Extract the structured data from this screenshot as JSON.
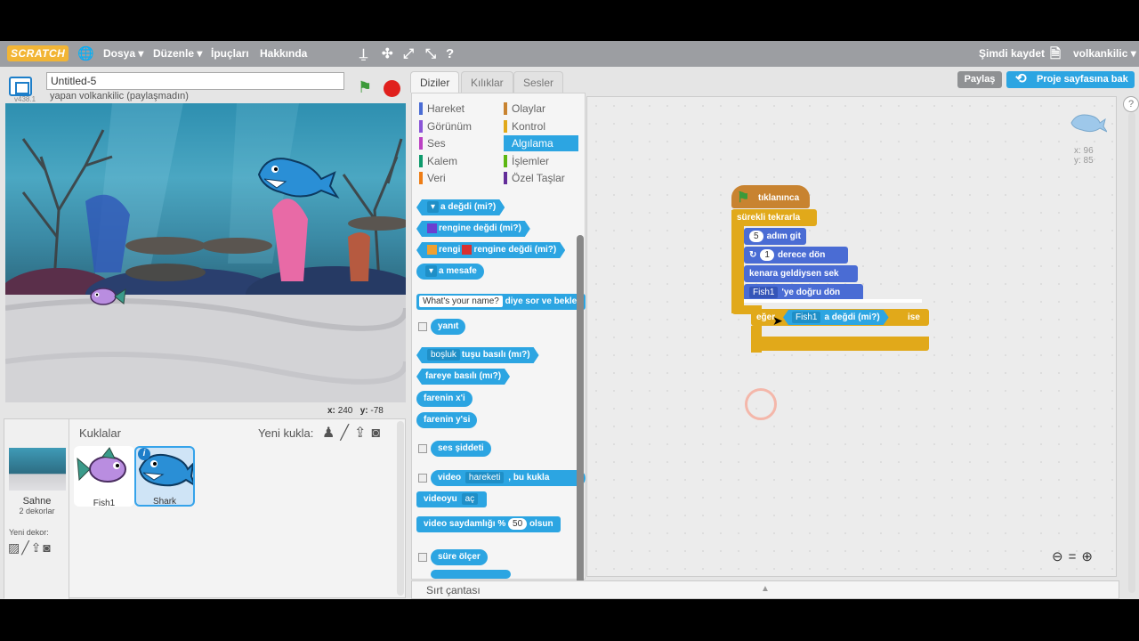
{
  "topbar": {
    "logo": "SCRATCH",
    "menus": [
      "Dosya ▾",
      "Düzenle ▾",
      "İpuçları",
      "Hakkında"
    ],
    "save_now": "Şimdi kaydet",
    "username": "volkankilic ▾"
  },
  "stage": {
    "project_title": "Untitled-5",
    "owner_text": "yapan volkankilic (paylaşmadın)",
    "version": "v438.1",
    "coords_x_label": "x:",
    "coords_x": "240",
    "coords_y_label": "y:",
    "coords_y": "-78"
  },
  "sprites_panel": {
    "stage_label": "Sahne",
    "backdrops_count": "2 dekorlar",
    "new_backdrop": "Yeni dekor:",
    "sprites_title": "Kuklalar",
    "new_sprite": "Yeni kukla:",
    "sprites": [
      {
        "name": "Fish1"
      },
      {
        "name": "Shark"
      }
    ],
    "info_glyph": "i"
  },
  "tabs": [
    "Diziler",
    "Kılıklar",
    "Sesler"
  ],
  "categories": [
    {
      "label": "Hareket",
      "color": "#4a6cd4"
    },
    {
      "label": "Olaylar",
      "color": "#c88330"
    },
    {
      "label": "Görünüm",
      "color": "#8a55d7"
    },
    {
      "label": "Kontrol",
      "color": "#e1a91a"
    },
    {
      "label": "Ses",
      "color": "#bb42c3"
    },
    {
      "label": "Algılama",
      "color": "#2ca5e2"
    },
    {
      "label": "Kalem",
      "color": "#0e9a6c"
    },
    {
      "label": "İşlemler",
      "color": "#5cb712"
    },
    {
      "label": "Veri",
      "color": "#ee7d16"
    },
    {
      "label": "Özel Taşlar",
      "color": "#632d99"
    }
  ],
  "palette": {
    "touching": "a değdi (mi?)",
    "touching_color": "rengine değdi (mi?)",
    "color_word": "rengi",
    "color_touching_color": "rengine değdi (mi?)",
    "distance": "a mesafe",
    "ask_default": "What's your name?",
    "ask_suffix": "diye sor ve bekle",
    "answer": "yanıt",
    "key_option": "boşluk",
    "key_pressed": "tuşu basılı (mı?)",
    "mouse_down": "fareye basılı (mı?)",
    "mouse_x": "farenin x'i",
    "mouse_y": "farenin y'si",
    "loudness": "ses şiddeti",
    "video_word": "video",
    "video_option": "hareketi",
    "video_target": "bu kukla",
    "video_turn": "videoyu",
    "video_turn_option": "aç",
    "transparency": "video saydamlığı %",
    "transparency_value": "50",
    "transparency_suffix": "olsun",
    "timer": "süre ölçer"
  },
  "script": {
    "hat": "tıklanınca",
    "forever": "sürekli tekrarla",
    "move_steps_value": "5",
    "move_steps": "adım git",
    "turn_value": "1",
    "turn": "derece dön",
    "bounce": "kenara geldiysen sek",
    "point_target": "Fish1",
    "point_towards": "'ye doğru dön",
    "if": "eğer",
    "if_target": "Fish1",
    "if_touching": "a değdi (mi?)",
    "then": "ise"
  },
  "header_right": {
    "share": "Paylaş",
    "project_page": "Proje sayfasına bak"
  },
  "sprite_info": {
    "x_label": "x: 96",
    "y_label": "y: 85"
  },
  "backpack": "Sırt çantası",
  "accent_color": "#2ca5e2",
  "control_color": "#e1a91a",
  "motion_color": "#4a6cd4"
}
